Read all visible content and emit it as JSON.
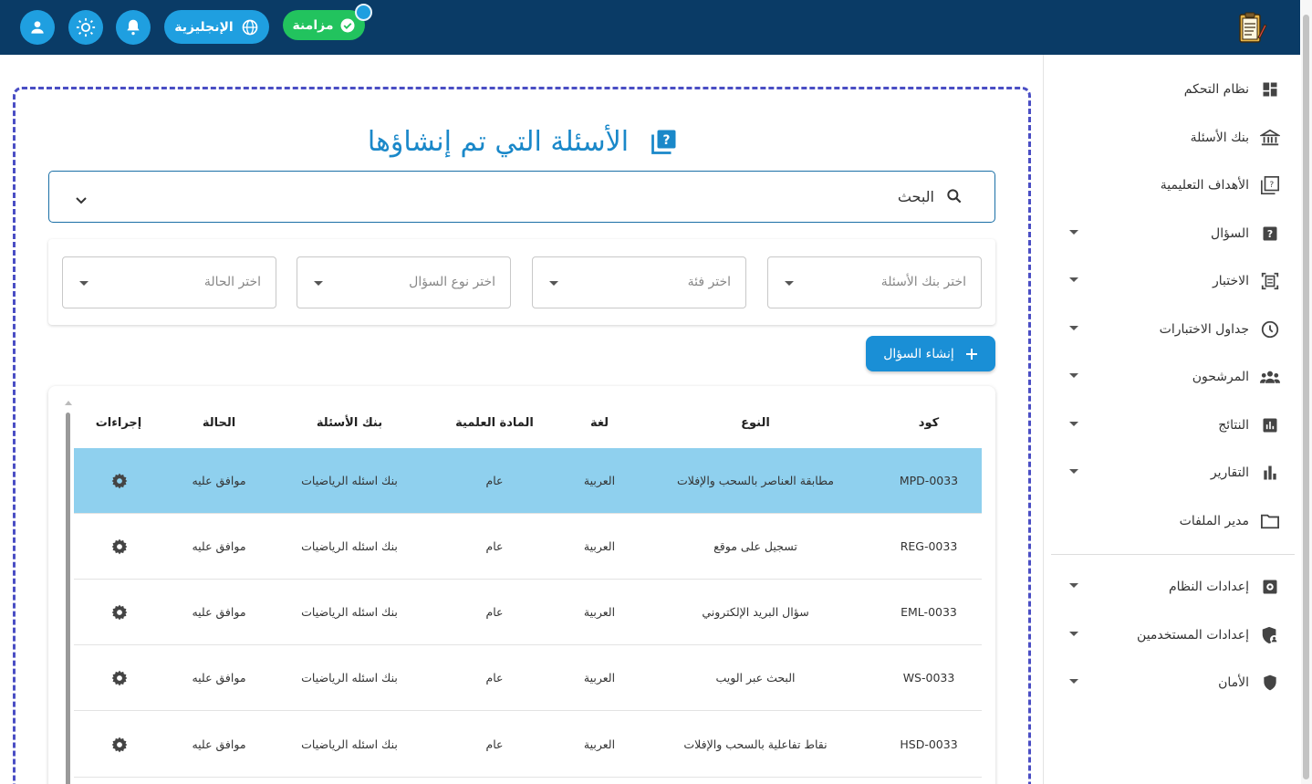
{
  "topbar": {
    "sync_label": "مزامنة",
    "language_label": "الإنجليزية",
    "icons": {
      "sync": "check-circle-icon",
      "language": "globe-icon",
      "notifications": "bell-icon",
      "theme": "sun-icon",
      "profile": "user-icon",
      "logo": "exam-clipboard-icon"
    }
  },
  "sidebar": {
    "items": [
      {
        "label": "نظام التحكم",
        "icon": "dashboard-icon",
        "has_caret": false
      },
      {
        "label": "بنك الأسئلة",
        "icon": "bank-icon",
        "has_caret": false
      },
      {
        "label": "الأهداف التعليمية",
        "icon": "objectives-icon",
        "has_caret": false
      },
      {
        "label": "السؤال",
        "icon": "question-icon",
        "has_caret": true
      },
      {
        "label": "الاختبار",
        "icon": "exam-icon",
        "has_caret": true
      },
      {
        "label": "جداول الاختبارات",
        "icon": "clock-icon",
        "has_caret": true
      },
      {
        "label": "المرشحون",
        "icon": "people-icon",
        "has_caret": true
      },
      {
        "label": "النتائج",
        "icon": "results-icon",
        "has_caret": true
      },
      {
        "label": "التقارير",
        "icon": "bar-chart-icon",
        "has_caret": true
      },
      {
        "label": "مدير الملفات",
        "icon": "folder-icon",
        "has_caret": false
      },
      {
        "label": "إعدادات النظام",
        "icon": "settings-box-icon",
        "has_caret": true
      },
      {
        "label": "إعدادات المستخدمين",
        "icon": "user-shield-icon",
        "has_caret": true
      },
      {
        "label": "الأمان",
        "icon": "shield-icon",
        "has_caret": true
      }
    ]
  },
  "main": {
    "title": "الأسئلة التي تم إنشاؤها",
    "search_label": "البحث",
    "filters": {
      "bank": "اختر بنك الأسئلة",
      "category": "اختر فئة",
      "question_type": "اختر نوع السؤال",
      "status": "اختر الحالة"
    },
    "create_button": "إنشاء السؤال",
    "table": {
      "headers": {
        "code": "كود",
        "type": "النوع",
        "language": "لغة",
        "subject": "المادة العلمية",
        "bank": "بنك الأسئلة",
        "status": "الحالة",
        "actions": "إجراءات"
      },
      "rows": [
        {
          "code": "MPD-0033",
          "type": "مطابقة العناصر بالسحب والإفلات",
          "language": "العربية",
          "subject": "عام",
          "bank": "بنك اسئله الرياضيات",
          "status": "موافق عليه"
        },
        {
          "code": "REG-0033",
          "type": "تسجيل على موقع",
          "language": "العربية",
          "subject": "عام",
          "bank": "بنك اسئله الرياضيات",
          "status": "موافق عليه"
        },
        {
          "code": "EML-0033",
          "type": "سؤال البريد الإلكتروني",
          "language": "العربية",
          "subject": "عام",
          "bank": "بنك اسئله الرياضيات",
          "status": "موافق عليه"
        },
        {
          "code": "WS-0033",
          "type": "البحث عبر الويب",
          "language": "العربية",
          "subject": "عام",
          "bank": "بنك اسئله الرياضيات",
          "status": "موافق عليه"
        },
        {
          "code": "HSD-0033",
          "type": "نقاط تفاعلية بالسحب والإفلات",
          "language": "العربية",
          "subject": "عام",
          "bank": "بنك اسئله الرياضيات",
          "status": "موافق عليه"
        }
      ]
    }
  },
  "colors": {
    "topbar": "#0a3b66",
    "accent": "#1f9fe0",
    "sync": "#22c35e",
    "selected_row": "#8fd0ee",
    "title": "#1a88c9"
  }
}
